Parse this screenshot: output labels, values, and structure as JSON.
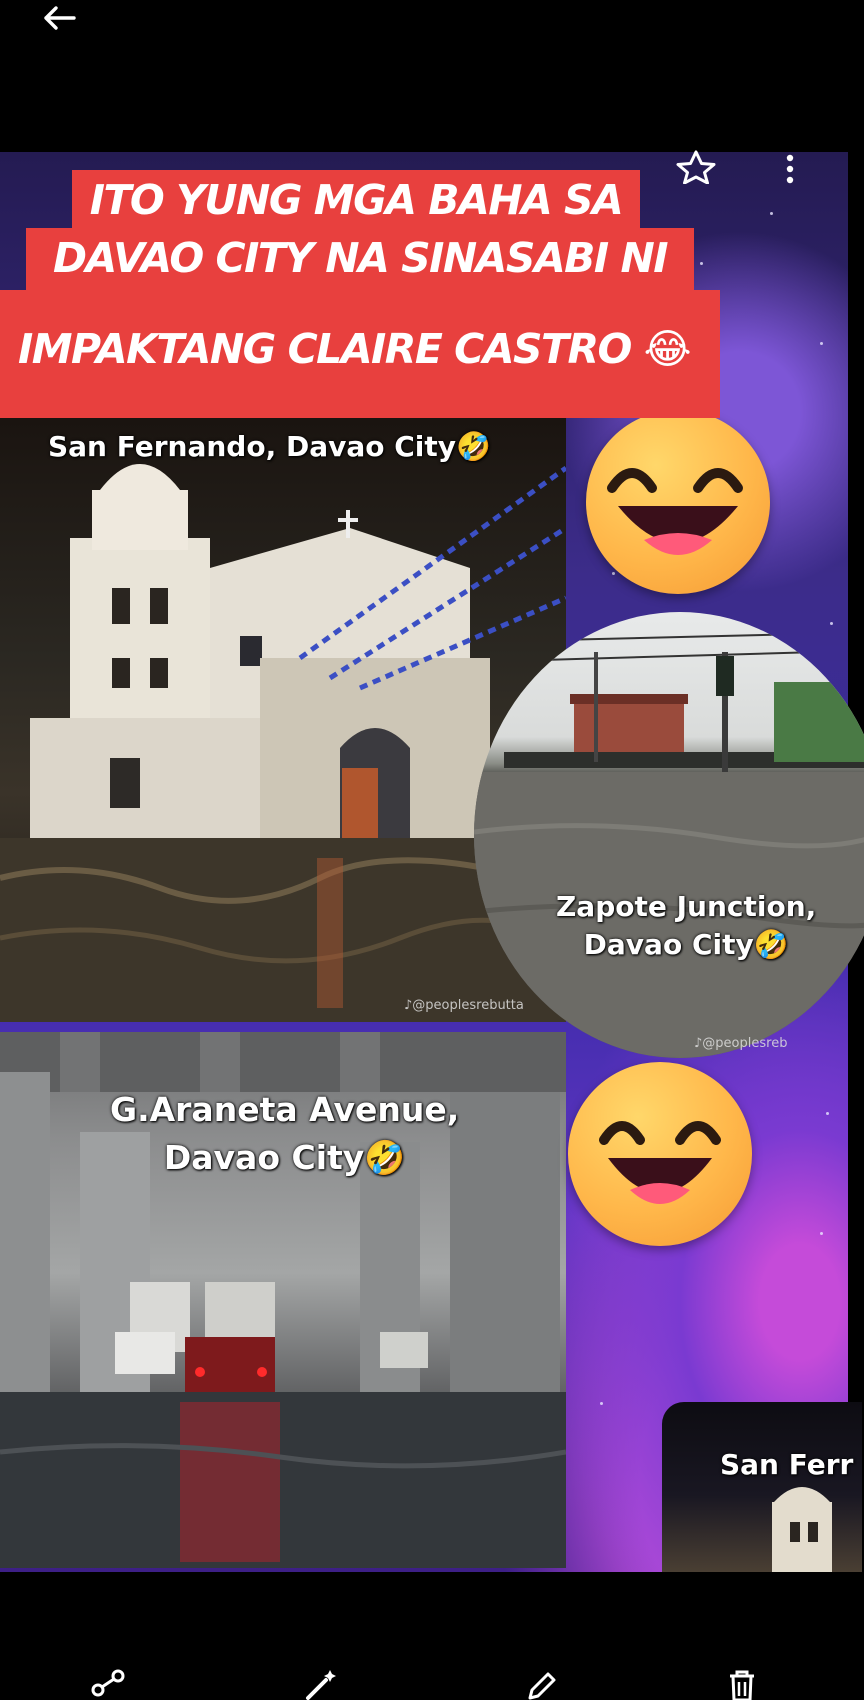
{
  "banner": {
    "line1": "ITO YUNG MGA BAHA SA",
    "line2": "DAVAO CITY NA SINASABI NI",
    "line3": "IMPAKTANG CLAIRE CASTRO 😂"
  },
  "photos": {
    "san_fernando": {
      "caption": "San Fernando, Davao City🤣",
      "watermark": "♪@peoplesrebutta"
    },
    "zapote": {
      "caption_line1": "Zapote Junction,",
      "caption_line2": "Davao City🤣",
      "watermark": "♪@peoplesreb"
    },
    "araneta": {
      "caption_line1": "G.Araneta Avenue,",
      "caption_line2": "Davao City🤣"
    },
    "thumbnail": {
      "caption": "San Ferr"
    }
  },
  "icons": {
    "top": [
      "back-icon",
      "star-icon",
      "more-vert-icon"
    ],
    "bottom": [
      "share-icon",
      "magic-edit-icon",
      "edit-icon",
      "delete-icon"
    ],
    "emoji": [
      "laughing-face-icon",
      "laughing-face-icon"
    ]
  },
  "colors": {
    "banner": "#e8403e",
    "background": "#000000"
  }
}
